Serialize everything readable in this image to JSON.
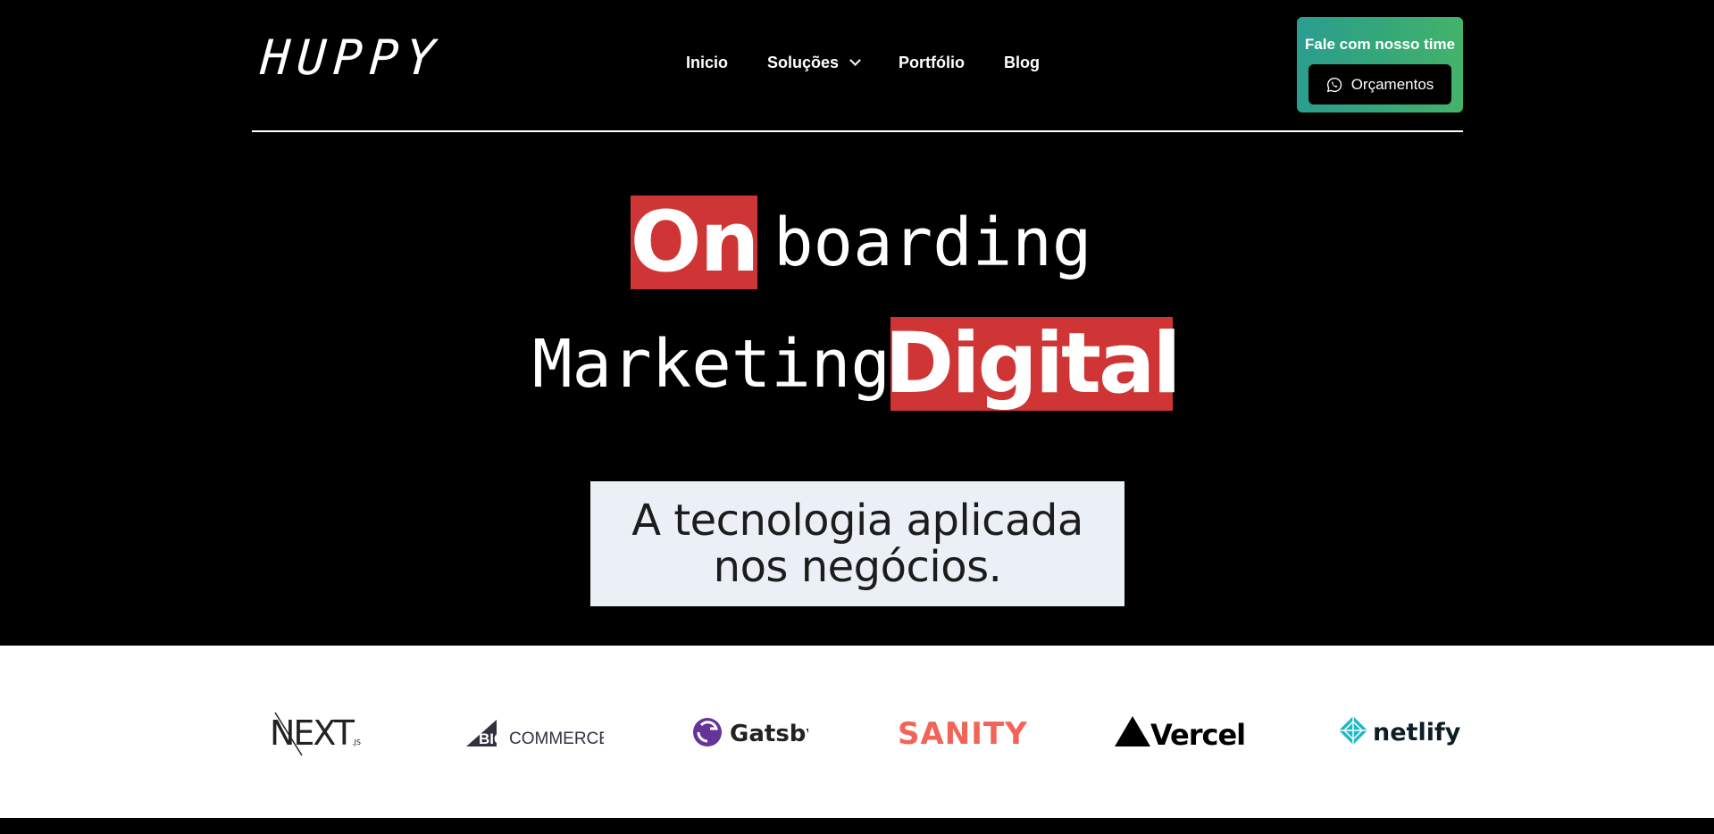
{
  "header": {
    "logo": "HUPPY",
    "nav": [
      "Inicio",
      "Soluções",
      "Portfólio",
      "Blog"
    ],
    "cta_title": "Fale com nosso time",
    "cta_button": "Orçamentos"
  },
  "hero": {
    "word_on": "On",
    "word_boarding": "boarding",
    "word_marketing": "Marketing",
    "word_digital": "Digital",
    "tagline_line1": "A tecnologia aplicada",
    "tagline_line2": "nos negócios.",
    "accent_color": "#d03535"
  },
  "partners": {
    "next_main": "NEXT",
    "next_sub": ".JS",
    "big": "BIG",
    "commerce": "COMMERCE",
    "gatsby": "Gatsby",
    "sanity": "SANITY",
    "vercel": "Vercel",
    "netlify": "netlify"
  }
}
